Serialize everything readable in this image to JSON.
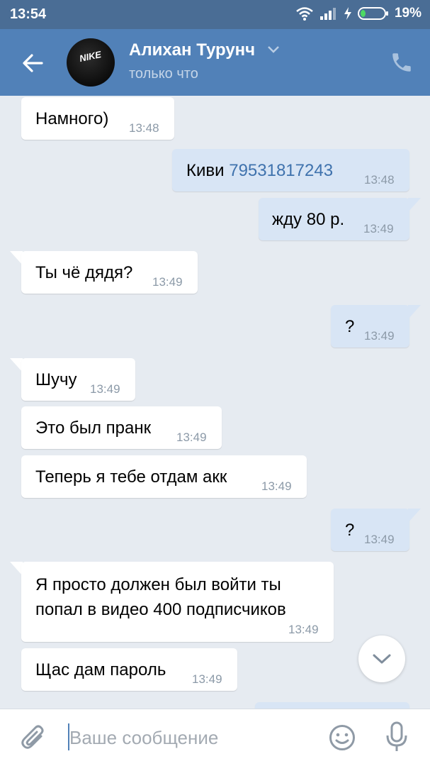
{
  "status_bar": {
    "time": "13:54",
    "battery": "19%"
  },
  "header": {
    "name": "Алихан Турунч",
    "status": "только что",
    "avatar_logo": "NIKE"
  },
  "messages": [
    {
      "dir": "in",
      "text": "Намного)",
      "time": "13:48"
    },
    {
      "dir": "out",
      "prefix": "Киви ",
      "link": "79531817243",
      "time": "13:48"
    },
    {
      "dir": "out",
      "text": "жду 80 р.",
      "time": "13:49"
    },
    {
      "dir": "in",
      "text": "Ты чё дядя?",
      "time": "13:49"
    },
    {
      "dir": "out",
      "text": "?",
      "time": "13:49"
    },
    {
      "dir": "in",
      "text": "Шучу",
      "time": "13:49"
    },
    {
      "dir": "in",
      "text": "Это был пранк",
      "time": "13:49"
    },
    {
      "dir": "in",
      "text": "Теперь я тебе отдам акк",
      "time": "13:49"
    },
    {
      "dir": "out",
      "text": "?",
      "time": "13:49"
    },
    {
      "dir": "in",
      "line1": "Я просто должен был войти ты",
      "line2": "попал в видео 400 подписчиков",
      "time": "13:49"
    },
    {
      "dir": "in",
      "text": "Щас дам пароль",
      "time": "13:49"
    }
  ],
  "composer": {
    "placeholder": "Ваше сообщение"
  },
  "colors": {
    "header": "#5181b8",
    "status_bar": "#4a6d95",
    "outgoing_bubble": "#d8e5f5",
    "incoming_bubble": "#ffffff",
    "background": "#e6ebf1"
  },
  "icons": [
    "back-arrow-icon",
    "chevron-down-icon",
    "phone-icon",
    "attach-icon",
    "emoji-icon",
    "mic-icon",
    "wifi-icon",
    "signal-icon",
    "charging-icon",
    "battery-icon",
    "scroll-down-icon"
  ]
}
